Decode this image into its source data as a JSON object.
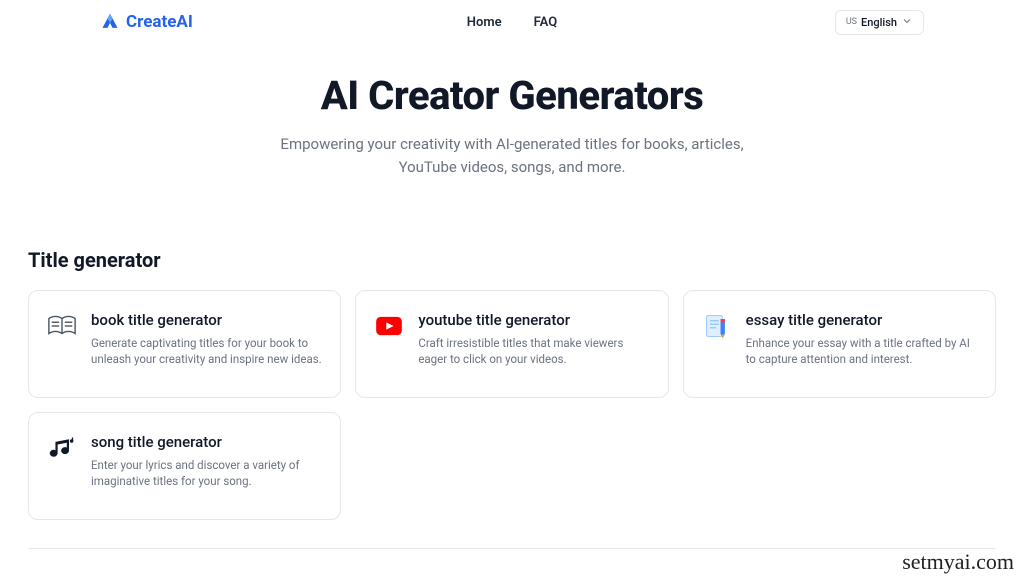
{
  "header": {
    "logo_text": "CreateAI",
    "nav": [
      {
        "label": "Home"
      },
      {
        "label": "FAQ"
      }
    ],
    "lang": {
      "code": "US",
      "name": "English"
    }
  },
  "hero": {
    "title": "AI Creator Generators",
    "subtitle": "Empowering your creativity with AI-generated titles for books, articles, YouTube videos, songs, and more."
  },
  "section": {
    "title": "Title generator",
    "cards": [
      {
        "title": "book title generator",
        "desc": "Generate captivating titles for your book to unleash your creativity and inspire new ideas."
      },
      {
        "title": "youtube title generator",
        "desc": "Craft irresistible titles that make viewers eager to click on your videos."
      },
      {
        "title": "essay title generator",
        "desc": "Enhance your essay with a title crafted by AI to capture attention and interest."
      },
      {
        "title": "song title generator",
        "desc": "Enter your lyrics and discover a variety of imaginative titles for your song."
      }
    ]
  },
  "watermark": "setmyai.com"
}
